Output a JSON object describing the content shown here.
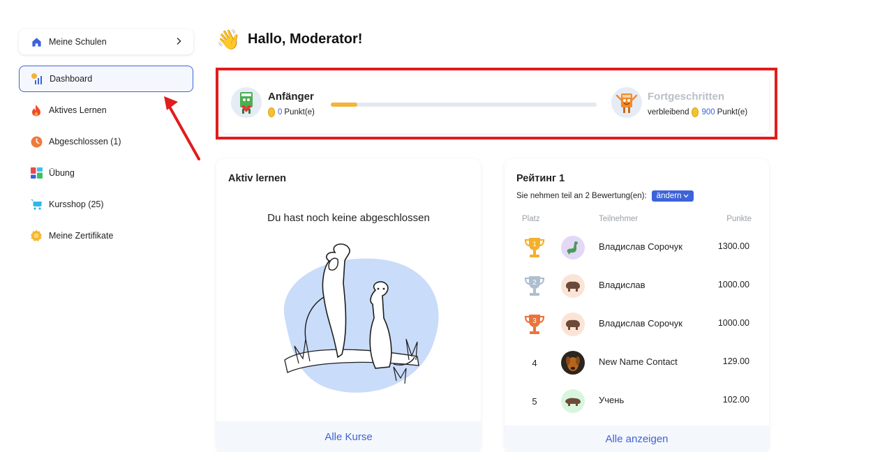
{
  "sidebar": {
    "schools_label": "Meine Schulen",
    "items": [
      {
        "label": "Dashboard",
        "icon": "dashboard-icon"
      },
      {
        "label": "Aktives Lernen",
        "icon": "fire-icon"
      },
      {
        "label": "Abgeschlossen (1)",
        "icon": "clock-icon"
      },
      {
        "label": "Übung",
        "icon": "grid-icon"
      },
      {
        "label": "Kursshop (25)",
        "icon": "cart-icon"
      },
      {
        "label": "Meine Zertifikate",
        "icon": "medal-icon"
      }
    ]
  },
  "header": {
    "greeting": "Hallo, Moderator!",
    "emoji": "👋"
  },
  "level": {
    "current_name": "Anfänger",
    "current_points": "0",
    "points_unit": "Punkt(e)",
    "next_name": "Fortgeschritten",
    "remaining_label": "verbleibend",
    "remaining_points": "900",
    "progress": 0.1
  },
  "active_card": {
    "title": "Aktiv lernen",
    "empty_text": "Du hast noch keine abgeschlossen",
    "footer": "Alle Kurse"
  },
  "rating": {
    "title": "Рейтинг 1",
    "subtitle": "Sie nehmen teil an 2 Bewertung(en):",
    "change_label": "ändern",
    "headers": {
      "place": "Platz",
      "participant": "Teilnehmer",
      "points": "Punkte"
    },
    "rows": [
      {
        "place": "1",
        "name": "Владислав Сорочук",
        "points": "1300.00",
        "avatar": "dino-icon"
      },
      {
        "place": "2",
        "name": "Владислав",
        "points": "1000.00",
        "avatar": "bison-icon"
      },
      {
        "place": "3",
        "name": "Владислав Сорочук",
        "points": "1000.00",
        "avatar": "bison-icon"
      },
      {
        "place": "4",
        "name": "New Name Contact",
        "points": "129.00",
        "avatar": "dog-photo"
      },
      {
        "place": "5",
        "name": "Учень",
        "points": "102.00",
        "avatar": "boar-icon"
      }
    ],
    "footer": "Alle anzeigen"
  },
  "colors": {
    "accent": "#3d63d8",
    "annotation": "#e11c1c",
    "progress": "#f2b43a"
  }
}
